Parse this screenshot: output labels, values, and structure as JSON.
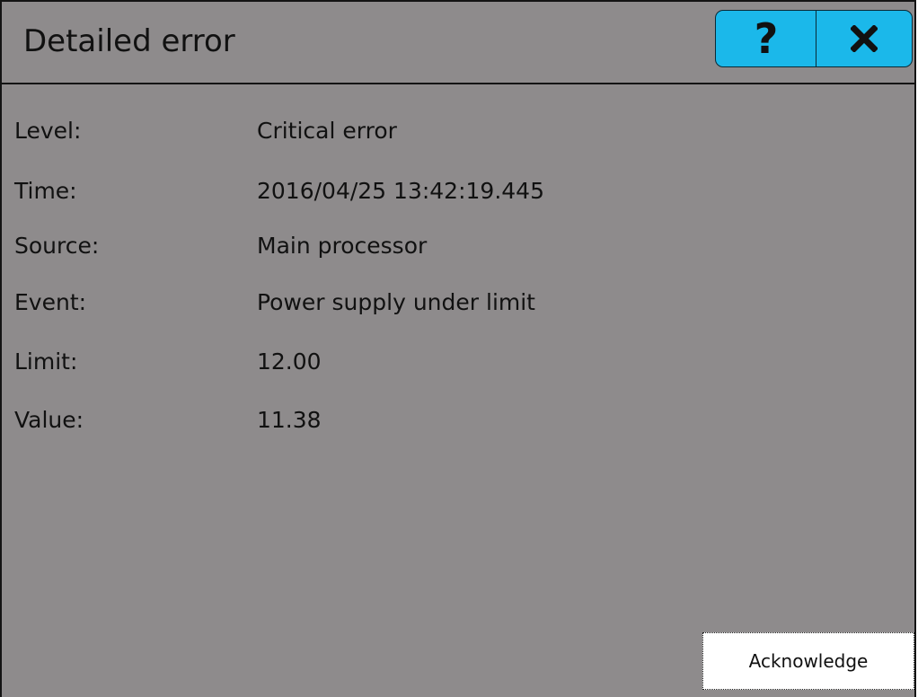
{
  "header": {
    "title": "Detailed error",
    "help_label": "?",
    "close_icon": "close-icon"
  },
  "details": [
    {
      "label": "Level:",
      "value": "Critical error"
    },
    {
      "label": "Time:",
      "value": "2016/04/25 13:42:19.445"
    },
    {
      "label": "Source:",
      "value": "Main processor"
    },
    {
      "label": "Event:",
      "value": "Power supply under limit"
    },
    {
      "label": "Limit:",
      "value": "12.00"
    },
    {
      "label": "Value:",
      "value": "11.38"
    }
  ],
  "footer": {
    "acknowledge_label": "Acknowledge"
  },
  "colors": {
    "background": "#8e8b8c",
    "accent_button": "#1bb8ea",
    "border": "#141414"
  }
}
